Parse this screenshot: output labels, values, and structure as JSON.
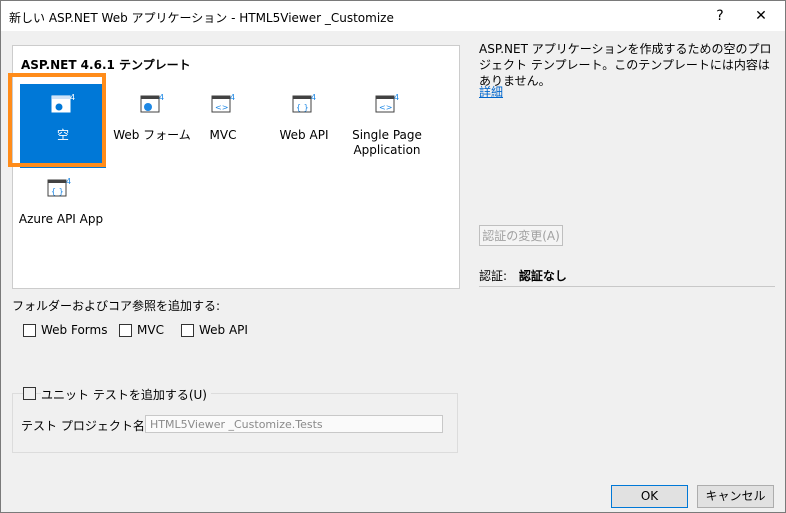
{
  "titlebar": {
    "title": "新しい ASP.NET Web アプリケーション - HTML5Viewer _Customize",
    "help_label": "?",
    "close_label": "✕"
  },
  "templates": {
    "heading": "ASP.NET 4.6.1 テンプレート",
    "items": [
      {
        "label": "空",
        "icon": "empty-template-icon"
      },
      {
        "label": "Web フォーム",
        "icon": "webforms-template-icon"
      },
      {
        "label": "MVC",
        "icon": "mvc-template-icon"
      },
      {
        "label": "Web API",
        "icon": "webapi-template-icon"
      },
      {
        "label": "Single Page Application",
        "icon": "spa-template-icon"
      },
      {
        "label": "Azure API App",
        "icon": "azure-api-template-icon"
      }
    ],
    "selected_index": 0
  },
  "description": {
    "text": "ASP.NET アプリケーションを作成するための空のプロジェクト テンプレート。このテンプレートには内容はありません。",
    "details_link": "詳細"
  },
  "auth": {
    "change_button": "認証の変更(A)",
    "label": "認証:",
    "value": "認証なし"
  },
  "folders": {
    "label": "フォルダーおよびコア参照を追加する:",
    "options": [
      {
        "label": "Web Forms",
        "checked": false
      },
      {
        "label": "MVC",
        "checked": false
      },
      {
        "label": "Web API",
        "checked": false
      }
    ]
  },
  "unit_test": {
    "checkbox_label": "ユニット テストを追加する(U)",
    "checked": false,
    "project_name_label": "テスト プロジェクト名(T):",
    "project_name_value": "HTML5Viewer _Customize.Tests"
  },
  "footer": {
    "ok_label": "OK",
    "cancel_label": "キャンセル"
  },
  "colors": {
    "selection": "#0078d7",
    "highlight_frame": "#ff8c1a",
    "link": "#0066cc"
  }
}
